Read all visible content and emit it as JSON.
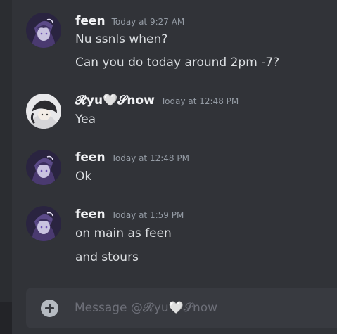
{
  "messages": [
    {
      "author": "feen",
      "timestamp": "Today at 9:27 AM",
      "avatar": "anime-avatar-purple",
      "lines": [
        "Nu ssnls when?",
        "Can you do today around 2pm -7?"
      ]
    },
    {
      "author": "𝓡yu🤍𝓢now",
      "timestamp": "Today at 12:48 PM",
      "avatar": "anime-avatar-white",
      "lines": [
        "Yea"
      ]
    },
    {
      "author": "feen",
      "timestamp": "Today at 12:48 PM",
      "avatar": "anime-avatar-purple",
      "lines": [
        "Ok"
      ]
    },
    {
      "author": "feen",
      "timestamp": "Today at 1:59 PM",
      "avatar": "anime-avatar-purple",
      "lines": [
        "on main as feen",
        "and stours"
      ]
    }
  ],
  "composer": {
    "placeholder": "Message @𝓡yu🤍𝓢now",
    "add_icon": "plus-circle-icon"
  },
  "colors": {
    "background": "#313338",
    "composer": "#383a40",
    "username": "#f2f3f5",
    "text": "#dbdee1",
    "timestamp": "#949ba4"
  }
}
